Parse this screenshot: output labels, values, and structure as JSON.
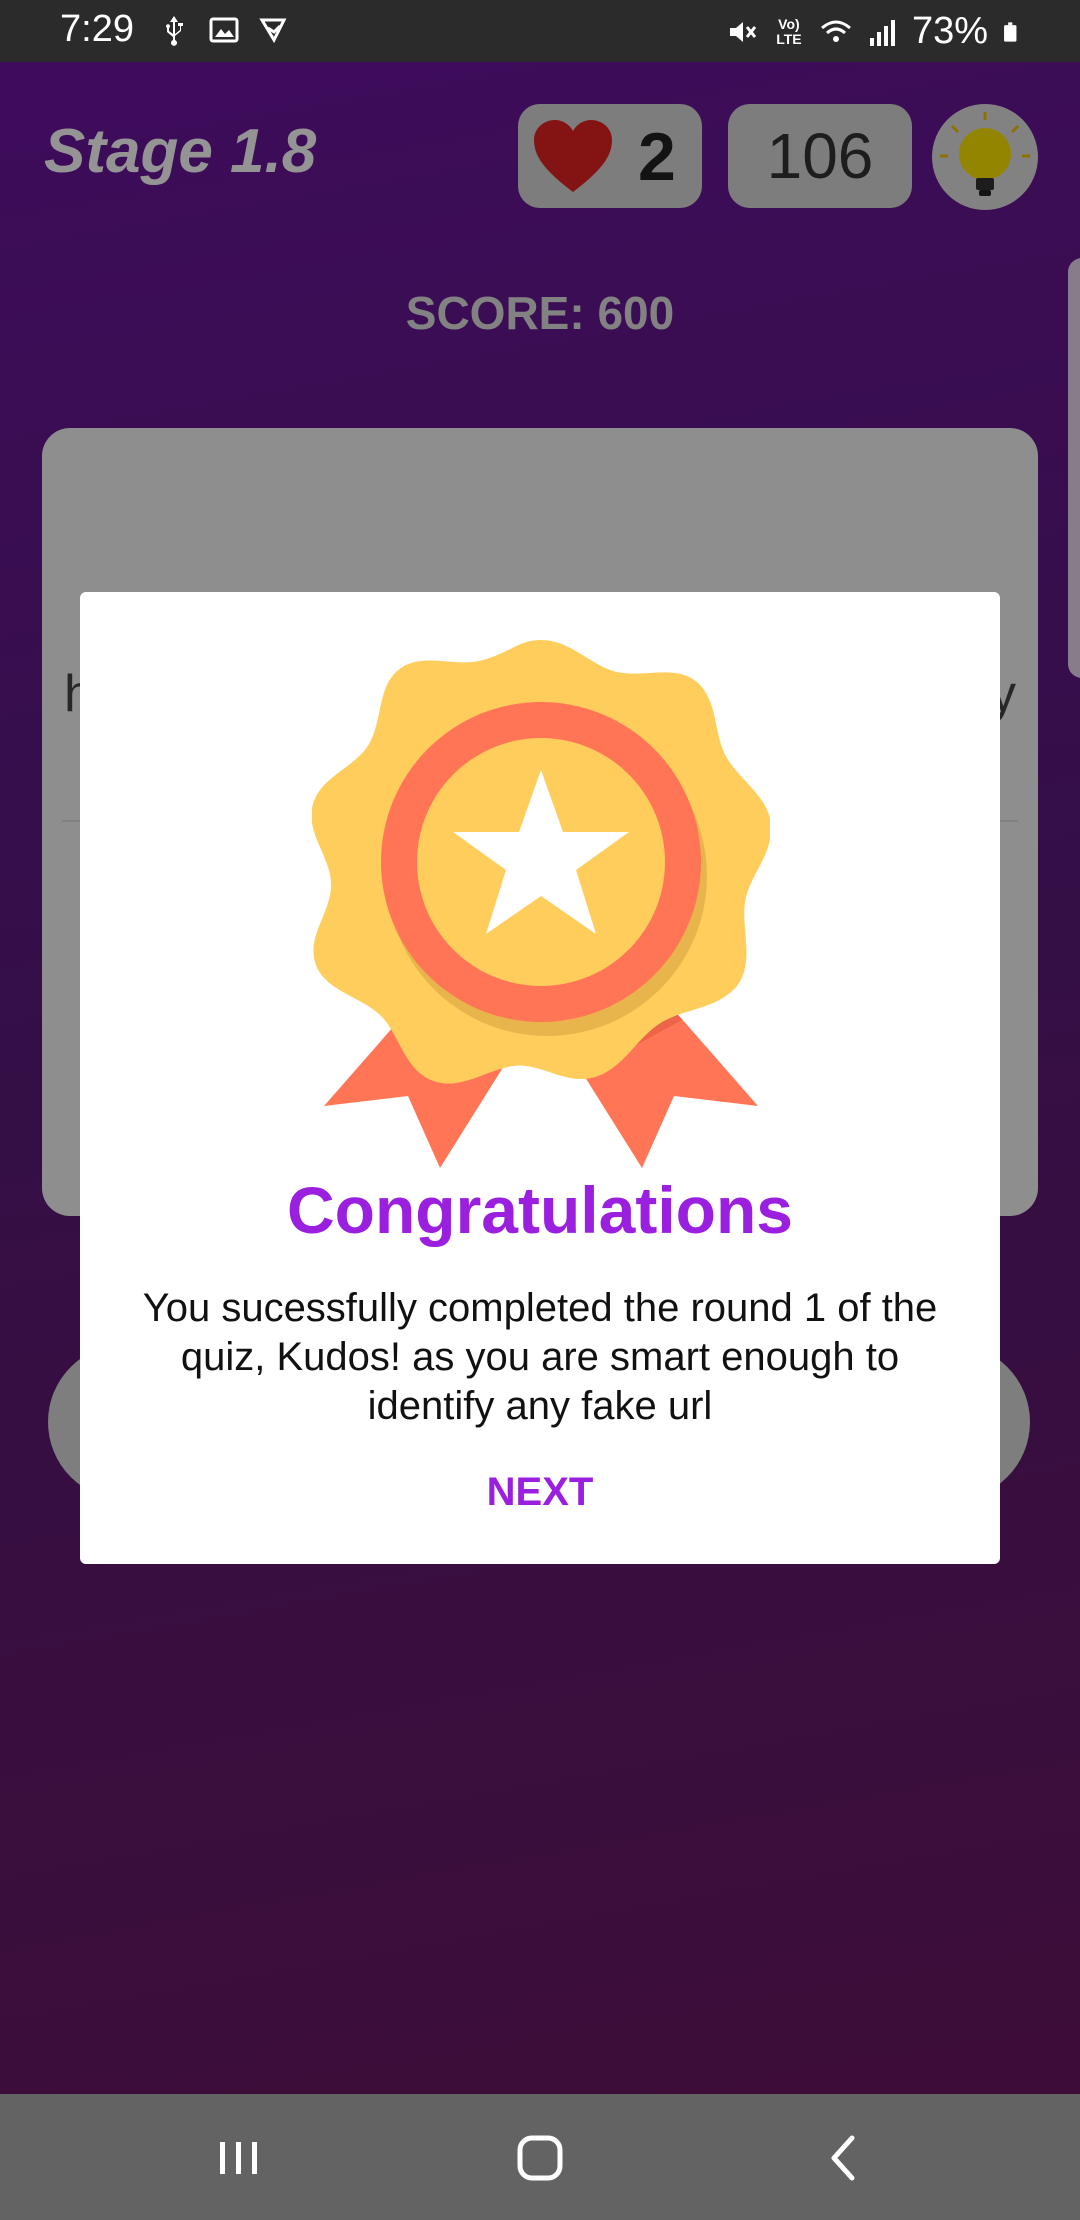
{
  "status_bar": {
    "time": "7:29",
    "battery": "73%",
    "lte_label": "Vo) LTE",
    "icons": [
      "usb-icon",
      "gallery-icon",
      "play-store-icon",
      "mute-icon",
      "volte-icon",
      "wifi-icon",
      "signal-icon",
      "battery-icon"
    ]
  },
  "game": {
    "stage": "Stage 1.8",
    "lives": "2",
    "timer": "106",
    "score": "SCORE: 600",
    "question_peek_left": "h",
    "question_peek_right": "y"
  },
  "dialog": {
    "title": "Congratulations",
    "message": "You sucessfully completed the round 1 of the quiz, Kudos! as you are smart enough to identify any fake url",
    "next_label": "NEXT",
    "icon": "award-badge-icon"
  },
  "nav_bar": {
    "icons": [
      "recent-apps-icon",
      "home-icon",
      "back-icon"
    ]
  },
  "colors": {
    "accent": "#9b1fdf",
    "badge_gold": "#ffcd5c",
    "badge_red": "#ff7555",
    "background": "#6a1fa0"
  }
}
